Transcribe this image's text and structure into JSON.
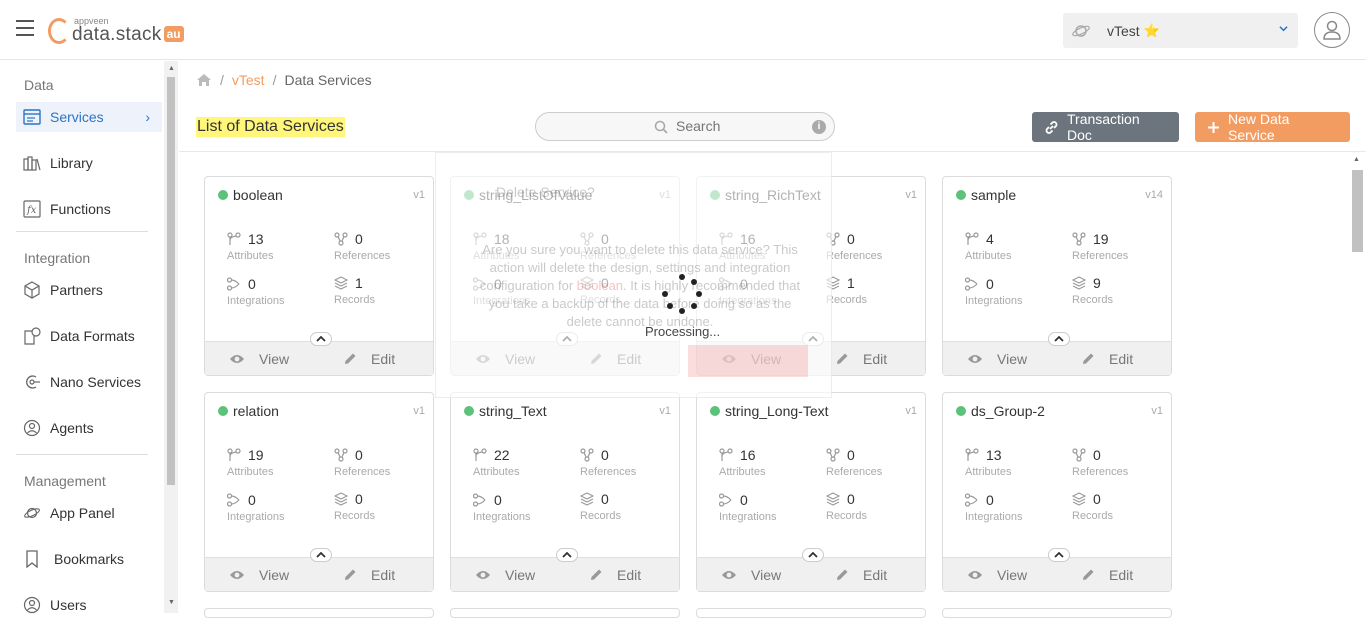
{
  "brand": {
    "small": "appveen",
    "name": "data.stack",
    "badge": "au"
  },
  "app_selector": {
    "value": "vTest",
    "star": "⭐"
  },
  "sidebar": {
    "sections": [
      {
        "title": "Data"
      },
      {
        "title": "Integration"
      },
      {
        "title": "Management"
      }
    ],
    "items": [
      {
        "label": "Services",
        "icon": "services-icon"
      },
      {
        "label": "Library",
        "icon": "library-icon"
      },
      {
        "label": "Functions",
        "icon": "functions-icon"
      },
      {
        "label": "Partners",
        "icon": "partners-icon"
      },
      {
        "label": "Data Formats",
        "icon": "data-formats-icon"
      },
      {
        "label": "Nano Services",
        "icon": "nano-services-icon"
      },
      {
        "label": "Agents",
        "icon": "agents-icon"
      },
      {
        "label": "App Panel",
        "icon": "app-panel-icon"
      },
      {
        "label": "Bookmarks",
        "icon": "bookmark-icon"
      },
      {
        "label": "Users",
        "icon": "users-icon"
      }
    ]
  },
  "breadcrumb": {
    "app": "vTest",
    "current": "Data Services"
  },
  "page": {
    "title": "List of Data Services",
    "search_placeholder": "Search",
    "transaction_doc": "Transaction Doc",
    "new_service": "New Data Service"
  },
  "labels": {
    "attributes": "Attributes",
    "references": "References",
    "integrations": "Integrations",
    "records": "Records",
    "view": "View",
    "edit": "Edit"
  },
  "cards": [
    {
      "name": "boolean",
      "version": "v1",
      "attributes": "13",
      "references": "0",
      "integrations": "0",
      "records": "1"
    },
    {
      "name": "string_ListOfValue",
      "version": "v1",
      "attributes": "18",
      "references": "0",
      "integrations": "0",
      "records": "0"
    },
    {
      "name": "string_RichText",
      "version": "v1",
      "attributes": "16",
      "references": "0",
      "integrations": "0",
      "records": "1"
    },
    {
      "name": "sample",
      "version": "v14",
      "attributes": "4",
      "references": "19",
      "integrations": "0",
      "records": "9"
    },
    {
      "name": "relation",
      "version": "v1",
      "attributes": "19",
      "references": "0",
      "integrations": "0",
      "records": "0"
    },
    {
      "name": "string_Text",
      "version": "v1",
      "attributes": "22",
      "references": "0",
      "integrations": "0",
      "records": "0"
    },
    {
      "name": "string_Long-Text",
      "version": "v1",
      "attributes": "16",
      "references": "0",
      "integrations": "0",
      "records": "0"
    },
    {
      "name": "ds_Group-2",
      "version": "v1",
      "attributes": "13",
      "references": "0",
      "integrations": "0",
      "records": "0"
    }
  ],
  "dialog": {
    "title_fragment": "Delete Service?",
    "body_before": "Are you sure you want to delete this data service? This action will delete the design, settings and integration configuration for ",
    "body_emph": "boolean",
    "body_after": ". It is highly recommended that you take a backup of the data before doing so as the delete cannot be undone.",
    "processing": "Processing..."
  },
  "colors": {
    "accent": "#f39c62",
    "active_link": "#2a73c6",
    "status_green": "#5cc27a",
    "highlight": "#fff67a"
  }
}
